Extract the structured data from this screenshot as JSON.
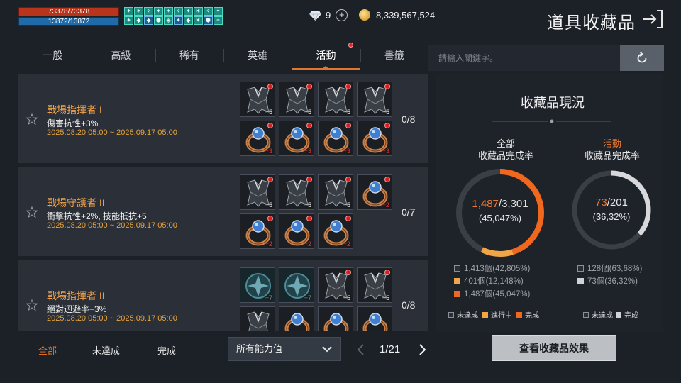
{
  "hud": {
    "hp": "73378/73378",
    "mp": "13872/13872",
    "buff_row1": [
      "✦",
      "✶",
      "✧",
      "✦",
      "✶",
      "✧",
      "✦",
      "✶",
      "✧",
      "✦"
    ],
    "buff_row2": [
      "✦",
      "◆",
      "◆",
      "⬢",
      "◈",
      "✦",
      "◆",
      "✶",
      "⬢",
      "✧"
    ]
  },
  "currency": {
    "gems": "9",
    "gold": "8,339,567,524"
  },
  "header": {
    "title": "道具收藏品"
  },
  "tabs": [
    {
      "label": "一般"
    },
    {
      "label": "高級"
    },
    {
      "label": "稀有"
    },
    {
      "label": "英雄"
    },
    {
      "label": "活動",
      "active": true,
      "notify": true
    },
    {
      "label": "書籤"
    }
  ],
  "entries": [
    {
      "name": "戰場指揮者 I",
      "effect": "傷害抗性+3%",
      "date": "2025.08.20 05:00 ~ 2025.09.17 05:00",
      "count": "0/8",
      "slots": [
        {
          "item": "armor",
          "plus": "+5",
          "dot": true
        },
        {
          "item": "armor",
          "plus": "+5",
          "dot": true
        },
        {
          "item": "armor",
          "plus": "+5",
          "dot": true
        },
        {
          "item": "armor",
          "plus": "+5",
          "dot": true
        },
        {
          "item": "ring",
          "plus": "+3",
          "plus_color": "red",
          "dot": true
        },
        {
          "item": "ring",
          "plus": "+3",
          "plus_color": "red",
          "dot": true
        },
        {
          "item": "ring",
          "plus": "+3",
          "plus_color": "red",
          "dot": true
        },
        {
          "item": "ring",
          "plus": "+3",
          "plus_color": "red",
          "dot": true
        }
      ]
    },
    {
      "name": "戰場守護者 II",
      "effect": "衝擊抗性+2%, 技能抵抗+5",
      "date": "2025.08.20 05:00 ~ 2025.09.17 05:00",
      "count": "0/7",
      "slots": [
        {
          "item": "armor",
          "plus": "+5",
          "dot": true
        },
        {
          "item": "armor",
          "plus": "+5",
          "dot": true
        },
        {
          "item": "armor",
          "plus": "+5",
          "dot": true
        },
        {
          "item": "ring",
          "plus": "+2",
          "plus_color": "red",
          "dot": true
        },
        {
          "item": "ring",
          "plus": "+2",
          "plus_color": "red",
          "dot": true
        },
        {
          "item": "ring",
          "plus": "+2",
          "plus_color": "red",
          "dot": true
        },
        {
          "item": "ring",
          "plus": "+2",
          "plus_color": "red",
          "dot": true
        }
      ]
    },
    {
      "name": "戰場指揮者 II",
      "effect": "絕對迴避率+3%",
      "date": "2025.08.20 05:00 ~ 2025.09.17 05:00",
      "count": "0/8",
      "slots": [
        {
          "item": "shield",
          "plus": "+7",
          "plus_color": "dim",
          "dot": false
        },
        {
          "item": "shield",
          "plus": "+7",
          "plus_color": "dim",
          "dot": false
        },
        {
          "item": "armor",
          "plus": "+5",
          "dot": true
        },
        {
          "item": "armor",
          "plus": "+5",
          "dot": true
        },
        {
          "item": "armor",
          "plus": "",
          "dot": false
        },
        {
          "item": "ring",
          "plus": "",
          "dot": false
        },
        {
          "item": "ring",
          "plus": "",
          "dot": false
        },
        {
          "item": "ring",
          "plus": "",
          "dot": false
        }
      ]
    }
  ],
  "filters": {
    "all": "全部",
    "incomplete": "未達成",
    "complete": "完成"
  },
  "ability_select": {
    "value": "所有能力值"
  },
  "pager": {
    "text": "1/21"
  },
  "search": {
    "placeholder": "請輸入關鍵字。"
  },
  "status": {
    "title": "收藏品現況",
    "overall": {
      "label1": "全部",
      "label2": "收藏品完成率",
      "done": "1,487",
      "total": "/3,301",
      "pct": "(45,047%)",
      "fraction": 0.45047,
      "stats": [
        {
          "text": "1,413個(42,805%)",
          "color": "#2a2f37",
          "border": "#8a9099"
        },
        {
          "text": "401個(12,148%)",
          "color": "#f2a546",
          "border": "#f2a546"
        },
        {
          "text": "1,487個(45,047%)",
          "color": "#f0681e",
          "border": "#f0681e"
        }
      ],
      "legend": [
        {
          "text": "未達成",
          "color": "#2a2f37",
          "border": "#8a9099"
        },
        {
          "text": "進行中",
          "color": "#f2a546",
          "border": "#f2a546"
        },
        {
          "text": "完成",
          "color": "#f0681e",
          "border": "#f0681e"
        }
      ]
    },
    "event": {
      "label1": "活動",
      "label2": "收藏品完成率",
      "done": "73",
      "total": "/201",
      "pct": "(36,32%)",
      "fraction": 0.3632,
      "stats": [
        {
          "text": "128個(63,68%)",
          "color": "#2a2f37",
          "border": "#8a9099"
        },
        {
          "text": "73個(36,32%)",
          "color": "#cfd2d6",
          "border": "#cfd2d6"
        }
      ],
      "legend": [
        {
          "text": "未達成",
          "color": "#2a2f37",
          "border": "#8a9099"
        },
        {
          "text": "完成",
          "color": "#cfd2d6",
          "border": "#cfd2d6"
        }
      ]
    }
  },
  "effect_button": {
    "label": "查看收藏品效果"
  },
  "colors": {
    "accent": "#f0772c",
    "completed": "#f0681e",
    "in_progress": "#f2a546",
    "event_ring": "#d6d8db"
  }
}
